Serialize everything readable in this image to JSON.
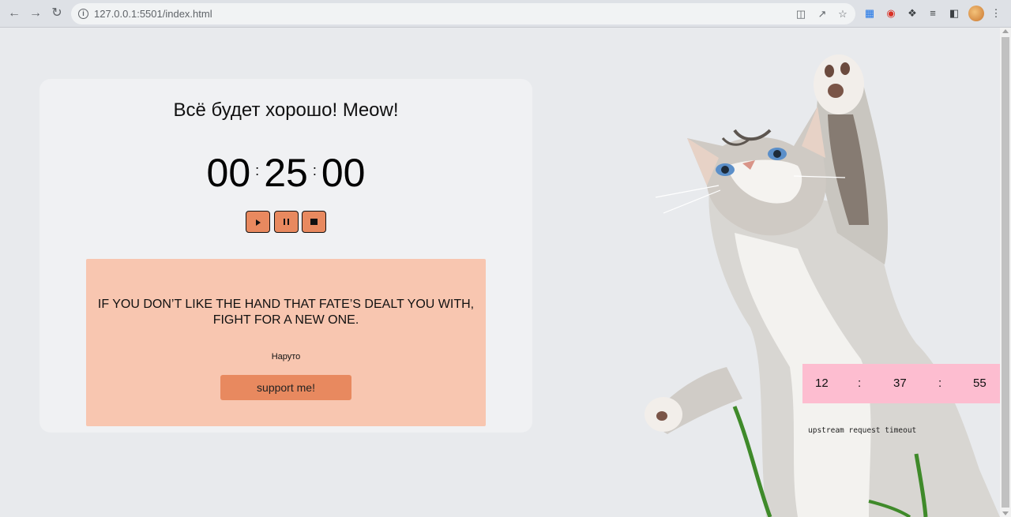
{
  "browser": {
    "url": "127.0.0.1:5501/index.html"
  },
  "card": {
    "title": "Всё будет хорошо! Meow!",
    "timer": {
      "hours": "00",
      "minutes": "25",
      "seconds": "00",
      "separator": ":"
    },
    "controls": {
      "play": "play",
      "pause": "pause",
      "stop": "stop"
    }
  },
  "quote": {
    "text": "IF YOU DON’T LIKE THE HAND THAT FATE’S DEALT YOU WITH, FIGHT FOR A NEW ONE.",
    "author": "Наруто",
    "support_label": "support me!"
  },
  "clock": {
    "hours": "12",
    "minutes": "37",
    "seconds": "55",
    "separator": ":"
  },
  "status": {
    "message": "upstream request timeout"
  },
  "colors": {
    "accent": "#e8895f",
    "quote_bg": "#f8c6b0",
    "clock_bg": "#fdbdd0",
    "page_bg": "#e8eaed"
  }
}
